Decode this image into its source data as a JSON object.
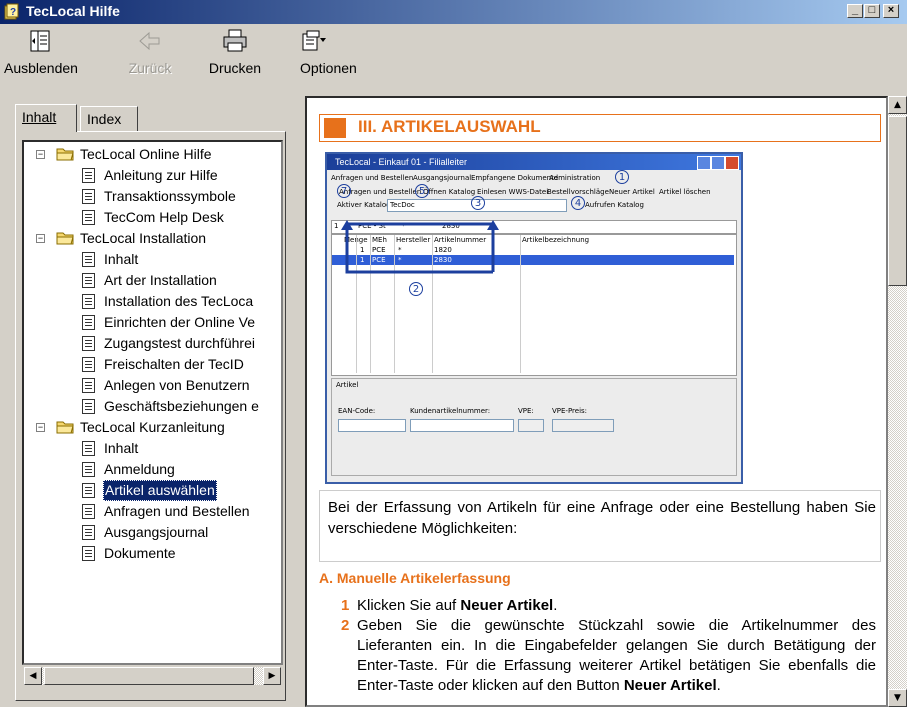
{
  "window": {
    "title": "TecLocal Hilfe",
    "min_label": "_",
    "max_label": "□",
    "close_label": "×"
  },
  "toolbar": {
    "hide_label": "Ausblenden",
    "back_label": "Zurück",
    "print_label": "Drucken",
    "options_label": "Optionen"
  },
  "tabs": {
    "contents_label": "Inhalt",
    "index_label": "Index"
  },
  "tree": {
    "group1": {
      "label": "TecLocal Online Hilfe",
      "items": [
        "Anleitung zur Hilfe",
        "Transaktionssymbole",
        "TecCom Help Desk"
      ]
    },
    "group2": {
      "label": "TecLocal Installation",
      "items": [
        "Inhalt",
        "Art der Installation",
        "Installation des TecLoca",
        "Einrichten der Online Ve",
        "Zugangstest durchführei",
        "Freischalten der TecID",
        "Anlegen von Benutzern",
        "Geschäftsbeziehungen e"
      ]
    },
    "group3": {
      "label": "TecLocal Kurzanleitung",
      "items": [
        "Inhalt",
        "Anmeldung",
        "Artikel auswählen",
        "Anfragen und Bestellen",
        "Ausgangsjournal",
        "Dokumente"
      ]
    }
  },
  "content": {
    "heading": "III. ARTIKELAUSWAHL",
    "intro": "Bei der Erfassung von Artikeln für eine Anfrage oder eine Bestellung haben Sie verschiedene Möglichkeiten:",
    "section_a": "A. Manuelle Artikelerfassung",
    "step1_num": "1",
    "step1_prefix": "Klicken Sie auf ",
    "step1_bold": "Neuer Artikel",
    "step1_suffix": ".",
    "step2_num": "2",
    "step2_text": "Geben Sie die gewünschte Stückzahl sowie die Artikelnummer des Lieferanten ein. In die Eingabefelder gelangen Sie durch Betätigung der Enter-Taste. Für die Erfassung weiterer Artikel betätigen Sie ebenfalls die Enter-Taste oder klicken auf den",
    "step2_cont": "Button ",
    "step2_bold": "Neuer Artikel",
    "step2_end": "."
  },
  "screenshot": {
    "title": "TecLocal - Einkauf 01 - Filialleiter",
    "tabs": [
      "Anfragen und Bestellen",
      "Ausgangsjournal",
      "Empfangene Dokumente",
      "Administration"
    ],
    "toolbar_items": [
      "Anfragen und Bestellen",
      "Öffnen Katalog",
      "Einlesen WWS-Datei",
      "Bestellvorschläge",
      "Neuer Artikel",
      "Artikel löschen"
    ],
    "catalog_label": "Aktiver Katalog:",
    "catalog_value": "TecDoc",
    "catalog_button": "Aufrufen Katalog",
    "filter_qty": "1",
    "filter_unit": "PCE - St",
    "filter_star": "*",
    "filter_article": "2830",
    "columns": [
      "Menge",
      "MEh",
      "Hersteller",
      "Artikelnummer",
      "Artikelbezeichnung"
    ],
    "rows": [
      {
        "qty": "1",
        "unit": "PCE",
        "manu": "*",
        "article": "1820"
      },
      {
        "qty": "1",
        "unit": "PCE",
        "manu": "*",
        "article": "2830"
      }
    ],
    "article_group": "Artikel",
    "fields": [
      "EAN-Code:",
      "Kundenartikelnummer:",
      "VPE:",
      "VPE-Preis:"
    ],
    "callouts": [
      "1",
      "2",
      "3",
      "4",
      "5",
      "7"
    ]
  }
}
